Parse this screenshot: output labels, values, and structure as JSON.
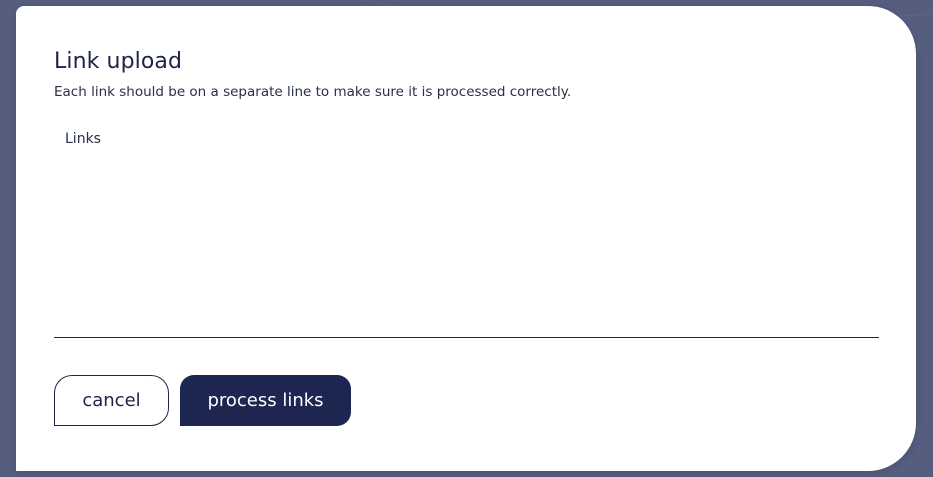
{
  "dialog": {
    "title": "Link upload",
    "subtitle": "Each link should be on a separate line to make sure it is processed correctly.",
    "links_field": {
      "placeholder": "Links",
      "value": ""
    },
    "buttons": {
      "cancel_label": "cancel",
      "process_label": "process links"
    }
  },
  "colors": {
    "backdrop": "#565e80",
    "dialog_bg": "#ffffff",
    "primary": "#1c2650",
    "text": "#1c2348"
  }
}
